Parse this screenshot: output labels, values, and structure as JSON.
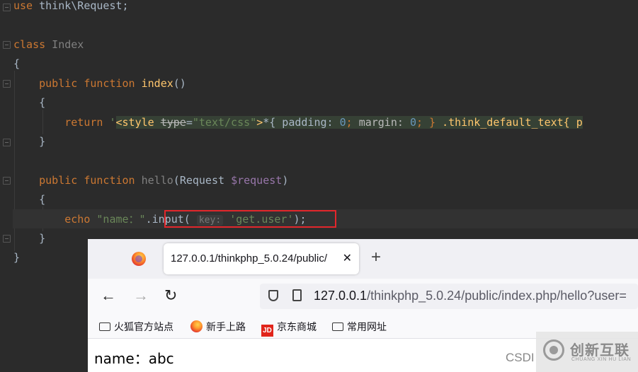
{
  "editor": {
    "line1": {
      "kw": "use",
      "rest": " think\\Request;"
    },
    "line_class": {
      "kw": "class",
      "name": " Index"
    },
    "brace_open": "{",
    "method1": {
      "kw": "public function",
      "name": "index",
      "parens": "()"
    },
    "method1_open": "{",
    "return_line": {
      "kw": "return",
      "quote": "'",
      "tag_open": "<style ",
      "attr": "type",
      "eq": "=",
      "attr_val": "\"text/css\"",
      "tag_close": ">",
      "css1": "*{ padding: ",
      "num1": "0",
      "semi1": "; ",
      "css2": "margin: ",
      "num2": "0",
      "css3": "; } ",
      "css4": ".think_default_text{ p"
    },
    "method1_close": "}",
    "method2": {
      "kw": "public function",
      "name": " hello",
      "paren_open": "(",
      "type": "Request ",
      "param": "$request",
      "paren_close": ")"
    },
    "method2_open": "{",
    "echo_line": {
      "kw": "echo",
      "str": "\"name：\"",
      "dot": ".",
      "call": "input(",
      "hint": "key:",
      "arg": "'get.user'",
      "end": ");"
    },
    "method2_close": "}",
    "class_close": "}"
  },
  "browser": {
    "tab_title": "127.0.0.1/thinkphp_5.0.24/public/",
    "tab_close_glyph": "✕",
    "newtab_glyph": "+",
    "back_glyph": "←",
    "forward_glyph": "→",
    "reload_glyph": "↻",
    "url_host": "127.0.0.1",
    "url_path": "/thinkphp_5.0.24/public/index.php/hello?user=",
    "bookmarks": [
      "火狐官方站点",
      "新手上路",
      "京东商城",
      "常用网址"
    ],
    "jd_badge": "JD",
    "page_text": "name：abc",
    "csdn": "CSDI"
  },
  "watermark": {
    "cn": "创新互联",
    "en": "CHUANG XIN HU LIAN"
  },
  "colors": {
    "highlight_box": "#e2262b",
    "editor_bg": "#2b2b2b",
    "keyword": "#cc7832",
    "function": "#ffc66d",
    "string": "#6a8759"
  }
}
